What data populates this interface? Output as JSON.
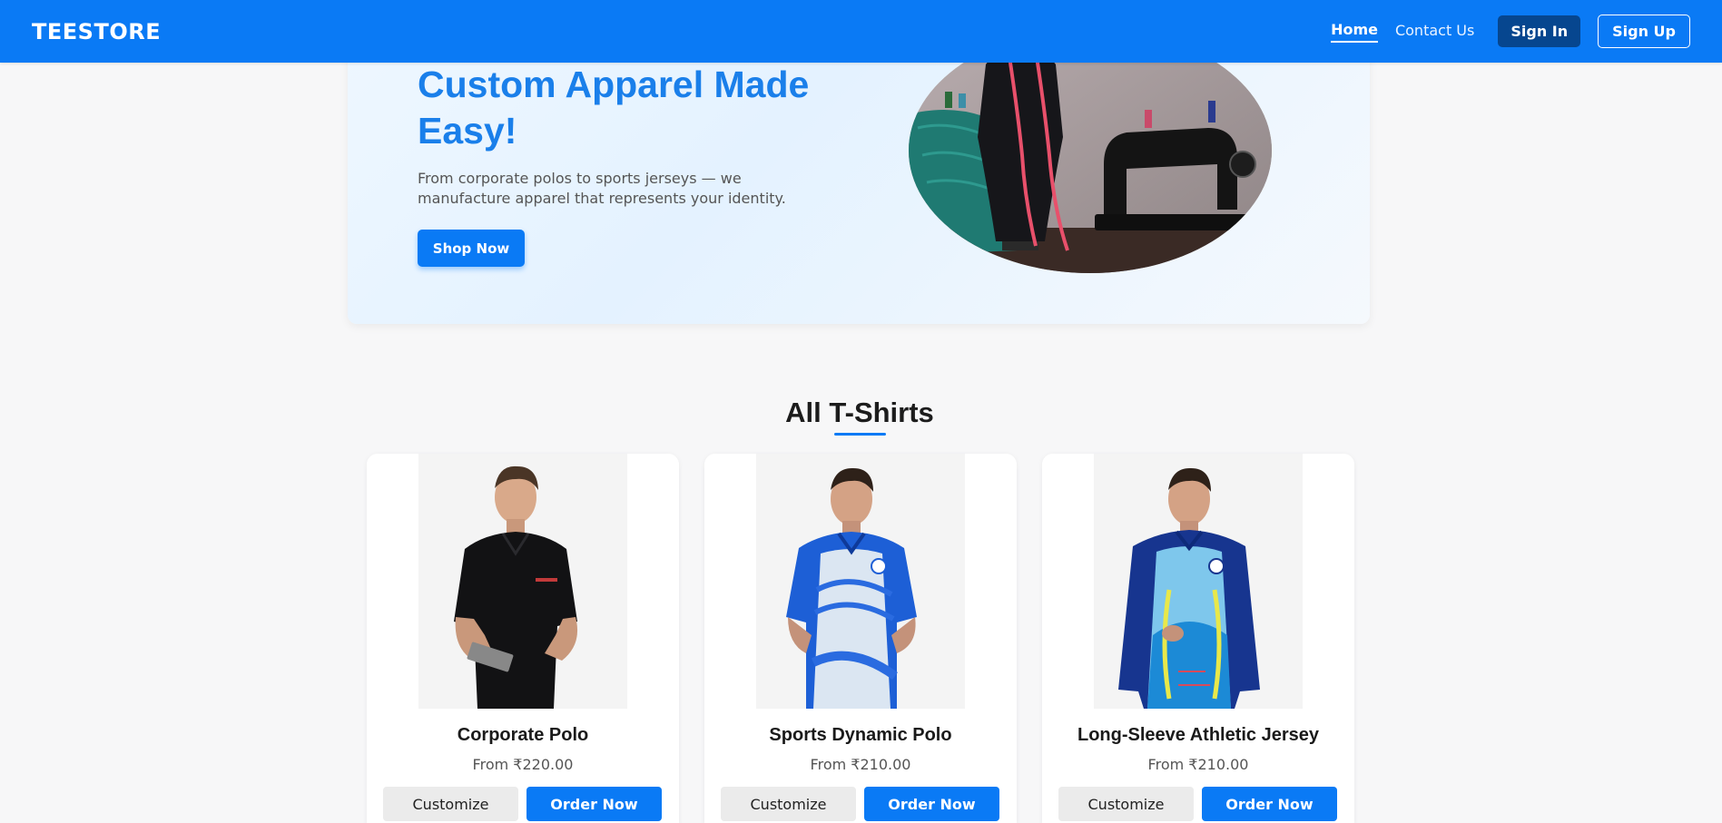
{
  "colors": {
    "primary": "#0a7af5",
    "sign_in_bg": "#06468f",
    "hero_title": "#1a7fea",
    "page_bg": "#f7f7f8"
  },
  "navbar": {
    "brand": "TEESTORE",
    "links": [
      {
        "label": "Home",
        "active": true
      },
      {
        "label": "Contact Us",
        "active": false
      }
    ],
    "sign_in": "Sign In",
    "sign_up": "Sign Up"
  },
  "hero": {
    "title": "Custom Apparel Made Easy!",
    "subtitle": "From corporate polos to sports jerseys — we manufacture apparel that represents your identity.",
    "cta": "Shop Now",
    "image_icon": "sewing-machine-mannequin-image"
  },
  "section": {
    "title": "All T-Shirts"
  },
  "products": [
    {
      "name": "Corporate Polo",
      "price": "From ₹220.00",
      "customize": "Customize",
      "order": "Order Now",
      "image_icon": "black-polo-image"
    },
    {
      "name": "Sports Dynamic Polo",
      "price": "From ₹210.00",
      "customize": "Customize",
      "order": "Order Now",
      "image_icon": "blue-sports-polo-image"
    },
    {
      "name": "Long-Sleeve Athletic Jersey",
      "price": "From ₹210.00",
      "customize": "Customize",
      "order": "Order Now",
      "image_icon": "long-sleeve-jersey-image"
    }
  ]
}
